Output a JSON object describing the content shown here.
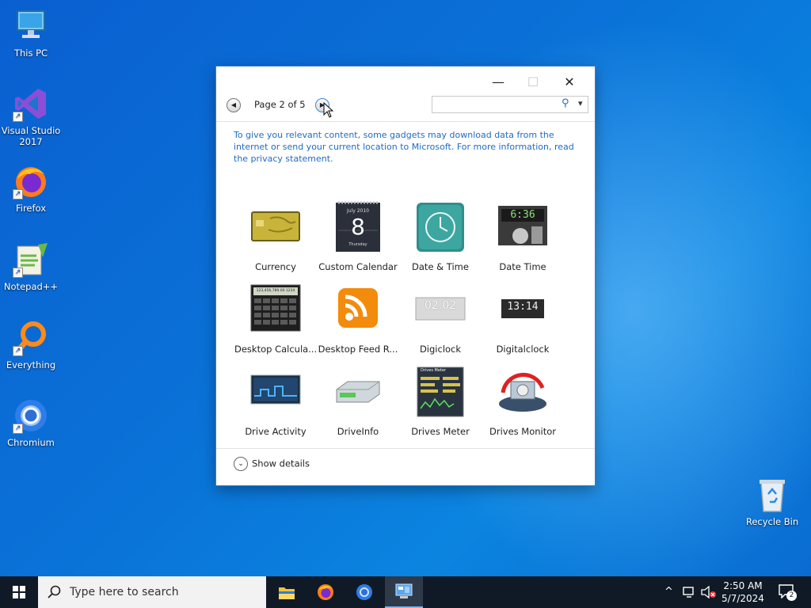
{
  "desktop": {
    "icons": [
      {
        "label": "This PC"
      },
      {
        "label": "Visual Studio 2017"
      },
      {
        "label": "Firefox"
      },
      {
        "label": "Notepad++"
      },
      {
        "label": "Everything"
      },
      {
        "label": "Chromium"
      },
      {
        "label": "Recycle Bin"
      }
    ]
  },
  "window": {
    "controls": {
      "minimize": "—",
      "maximize": "☐",
      "close": "✕"
    },
    "pager": {
      "label": "Page 2 of 5",
      "prev_glyph": "◀",
      "next_glyph": "▶"
    },
    "search": {
      "placeholder": "",
      "icon_glyph": "⚲",
      "dropdown_glyph": "▾"
    },
    "info_text": "To give you relevant content, some gadgets may download data from the internet or send your current location to Microsoft. For more information, read the privacy statement.",
    "gadgets": [
      {
        "label": "Currency"
      },
      {
        "label": "Custom Calendar",
        "month": "July 2010",
        "day": "8",
        "weekday": "Thursday"
      },
      {
        "label": "Date & Time"
      },
      {
        "label": "Date Time",
        "time": "6:36"
      },
      {
        "label": "Desktop Calcula...",
        "display": "123,456,789.00 1234"
      },
      {
        "label": "Desktop Feed R..."
      },
      {
        "label": "Digiclock",
        "time": "02:02"
      },
      {
        "label": "Digitalclock",
        "time": "13:14"
      },
      {
        "label": "Drive Activity"
      },
      {
        "label": "DriveInfo"
      },
      {
        "label": "Drives Meter",
        "title": "Drives Meter"
      },
      {
        "label": "Drives Monitor"
      }
    ],
    "show_details": {
      "label": "Show details",
      "glyph": "⌄"
    }
  },
  "taskbar": {
    "search_placeholder": "Type here to search",
    "clock": {
      "time": "2:50 AM",
      "date": "5/7/2024"
    },
    "notification_count": "2",
    "tray_up_glyph": "^"
  },
  "colors": {
    "accent": "#1f6bc4",
    "taskbar": "#101a26",
    "desktop": "#0a73d8"
  }
}
